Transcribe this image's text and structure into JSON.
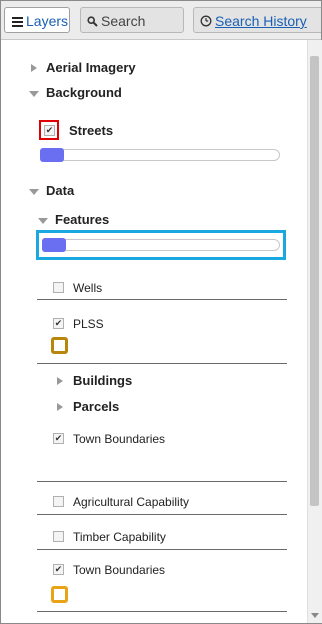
{
  "tabs": {
    "layers": "Layers",
    "search": "Search",
    "history": "Search History"
  },
  "tree": {
    "aerial": "Aerial Imagery",
    "background": "Background",
    "streets": "Streets",
    "streets_checked": true,
    "streets_opacity": 0.1,
    "data": "Data",
    "features": "Features",
    "features_opacity": 0.1,
    "wells": "Wells",
    "wells_checked": false,
    "plss": "PLSS",
    "plss_checked": true,
    "plss_color": "#b8860b",
    "buildings": "Buildings",
    "parcels": "Parcels",
    "town_boundaries_1": "Town Boundaries",
    "town_boundaries_1_checked": true,
    "agricultural": "Agricultural Capability",
    "agricultural_checked": false,
    "timber": "Timber Capability",
    "timber_checked": false,
    "town_boundaries_2": "Town Boundaries",
    "town_boundaries_2_checked": true,
    "town_boundaries_2_color": "#e8a317"
  },
  "colors": {
    "accent": "#1a5fb4",
    "slider_handle": "#6a6ef0",
    "highlight_red": "#e00000",
    "highlight_blue": "#19a8e0"
  }
}
